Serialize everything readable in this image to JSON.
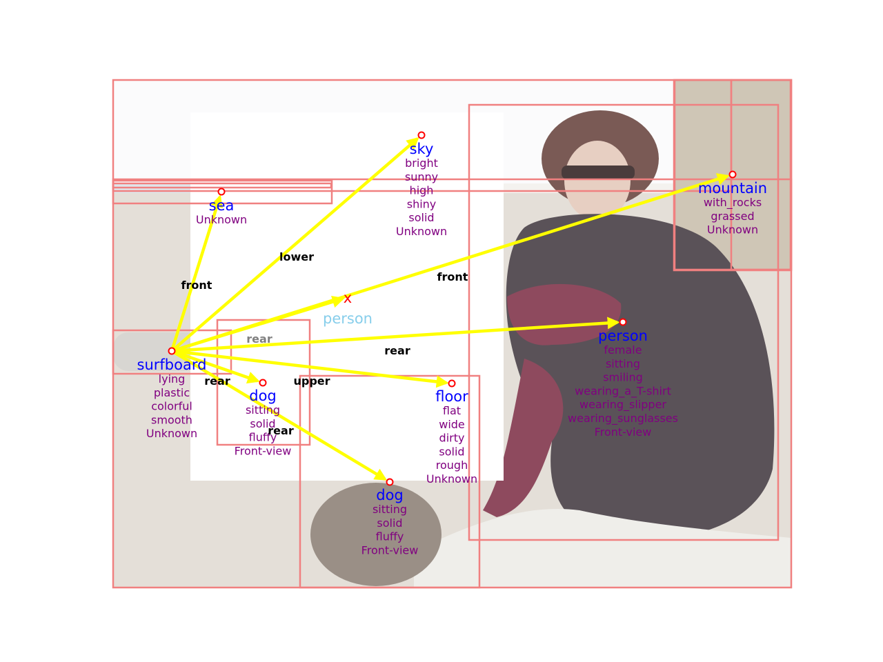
{
  "colors": {
    "box": "#f08080",
    "arrow": "#ffff00",
    "object_label": "#0000ff",
    "attribute_label": "#800080",
    "relation_label": "#000000",
    "hidden_relation_label": "#808080",
    "query_marker": "#ff0000",
    "query_label": "#87ceeb",
    "node_ring": "#ff0000"
  },
  "objects": [
    {
      "id": "sky",
      "name": "sky",
      "attributes": [
        "bright",
        "sunny",
        "high",
        "shiny",
        "solid",
        "Unknown"
      ]
    },
    {
      "id": "sea",
      "name": "sea",
      "attributes": [
        "Unknown"
      ]
    },
    {
      "id": "mountain",
      "name": "mountain",
      "attributes": [
        "with_rocks",
        "grassed",
        "Unknown"
      ]
    },
    {
      "id": "person",
      "name": "person",
      "attributes": [
        "female",
        "sitting",
        "smiling",
        "wearing_a_T-shirt",
        "wearing_slipper",
        "wearing_sunglasses",
        "Front-view"
      ]
    },
    {
      "id": "surfboard",
      "name": "surfboard",
      "attributes": [
        "lying",
        "plastic",
        "colorful",
        "smooth",
        "Unknown"
      ]
    },
    {
      "id": "dog1",
      "name": "dog",
      "attributes": [
        "sitting",
        "solid",
        "fluffy",
        "Front-view"
      ]
    },
    {
      "id": "floor",
      "name": "floor",
      "attributes": [
        "flat",
        "wide",
        "dirty",
        "solid",
        "rough",
        "Unknown"
      ]
    },
    {
      "id": "dog2",
      "name": "dog",
      "attributes": [
        "sitting",
        "solid",
        "fluffy",
        "Front-view"
      ]
    }
  ],
  "query": {
    "marker": "x",
    "name": "person"
  },
  "relations": [
    {
      "from": "surfboard",
      "to": "sea",
      "label": "front"
    },
    {
      "from": "surfboard",
      "to": "sky",
      "label": "lower"
    },
    {
      "from": "surfboard",
      "to": "mountain",
      "label": "front"
    },
    {
      "from": "surfboard",
      "to": "person",
      "label": "rear"
    },
    {
      "from": "surfboard",
      "to": "floor",
      "label": "upper"
    },
    {
      "from": "surfboard",
      "to": "dog1",
      "label": "rear"
    },
    {
      "from": "surfboard",
      "to": "dog2",
      "label": "rear"
    },
    {
      "from": "surfboard",
      "to": "query",
      "label": "rear",
      "muted": true
    }
  ]
}
